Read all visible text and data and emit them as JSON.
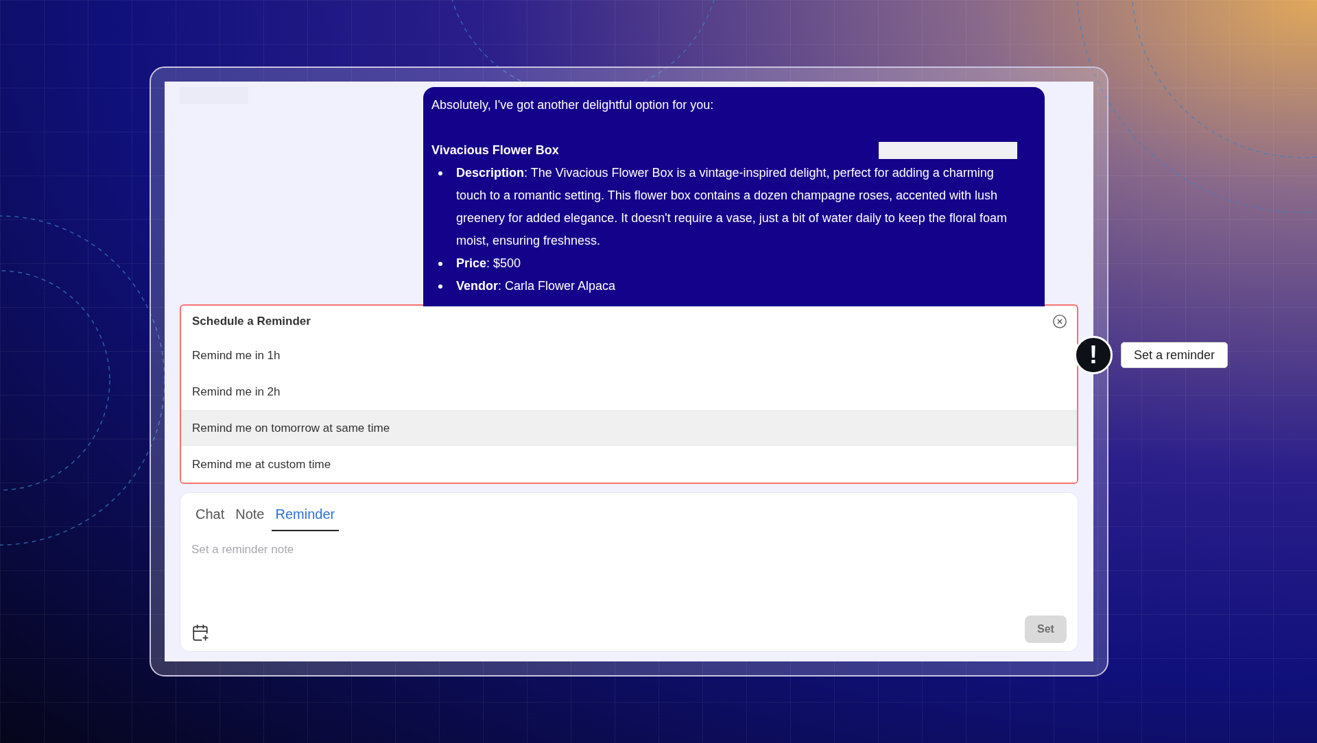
{
  "chat": {
    "message": {
      "intro": "Absolutely, I've got another delightful option for you:",
      "product_name": "Vivacious Flower Box",
      "details": [
        "**Description**: The Vivacious Flower Box is a vintage-inspired delight, perfect for adding a charming touch to a romantic setting. This flower box contains a dozen champagne roses, accented with lush greenery for added elegance. It doesn't require a vase, just a bit of water daily to keep the floral foam moist, ensuring freshness.",
        "**Price**: $500",
        "**Vendor**: Carla Flower Alpaca"
      ]
    }
  },
  "reminder_menu": {
    "title": "Schedule a Reminder",
    "options": [
      {
        "label": "Remind me in 1h",
        "selected": false
      },
      {
        "label": "Remind me in 2h",
        "selected": false
      },
      {
        "label": "Remind me on tomorrow at same time",
        "selected": true
      },
      {
        "label": "Remind me at custom time",
        "selected": false
      }
    ]
  },
  "composer": {
    "tabs": [
      {
        "label": "Chat",
        "selected": false
      },
      {
        "label": "Note",
        "selected": false
      },
      {
        "label": "Reminder",
        "selected": true
      }
    ],
    "placeholder": "Set a reminder note",
    "set_button": {
      "label": "Set",
      "disabled": true
    }
  },
  "callout": {
    "badge": "!",
    "label": "Set a reminder"
  }
}
